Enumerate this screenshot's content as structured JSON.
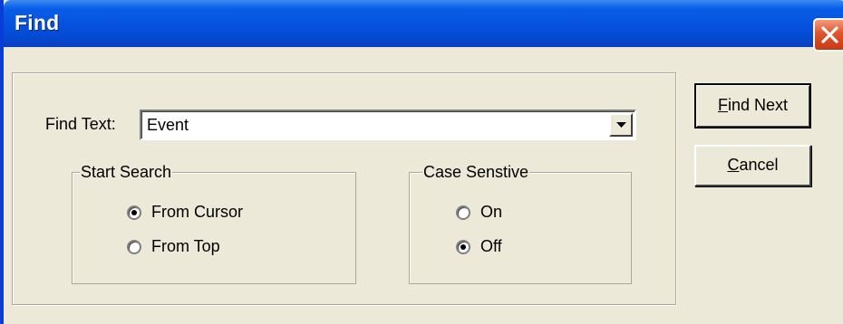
{
  "window": {
    "title": "Find"
  },
  "find_text": {
    "label": "Find Text:",
    "value": "Event"
  },
  "start_search": {
    "legend": "Start Search",
    "options": [
      {
        "label": "From Cursor",
        "selected": true
      },
      {
        "label": "From Top",
        "selected": false
      }
    ]
  },
  "case_sensitive": {
    "legend": "Case Senstive",
    "options": [
      {
        "label": "On",
        "selected": false
      },
      {
        "label": "Off",
        "selected": true
      }
    ]
  },
  "buttons": {
    "find_next_mnemonic": "F",
    "find_next_rest": "ind Next",
    "cancel_mnemonic": "C",
    "cancel_rest": "ancel"
  },
  "colors": {
    "titlebar": "#0553e0",
    "dialog_bg": "#ece9d8",
    "close_button": "#e0542c"
  },
  "icons": {
    "close": "close-icon",
    "dropdown": "chevron-down-icon"
  }
}
